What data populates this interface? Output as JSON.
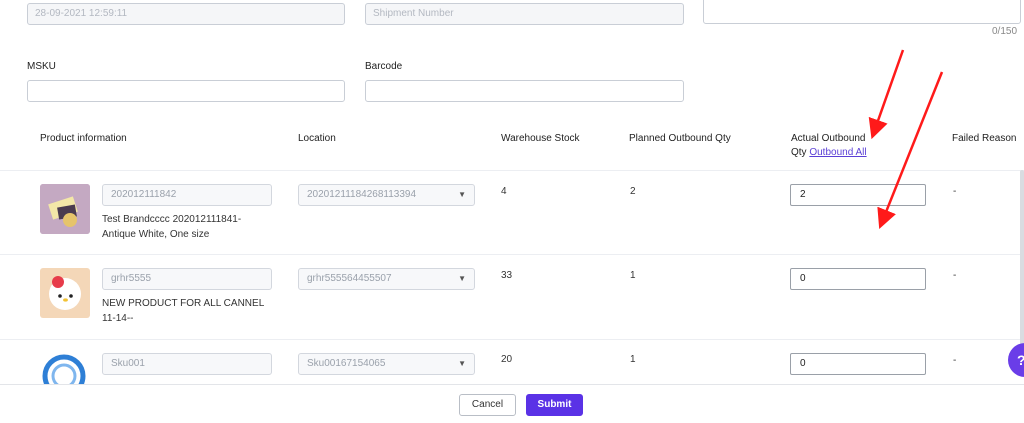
{
  "top_fields": {
    "date_value": "28-09-2021 12:59:11",
    "shipment_placeholder": "Shipment Number",
    "remark_counter": "0/150"
  },
  "filters": {
    "msku_label": "MSKU",
    "barcode_label": "Barcode"
  },
  "table": {
    "headers": {
      "product": "Product information",
      "location": "Location",
      "stock": "Warehouse Stock",
      "planned": "Planned Outbound Qty",
      "actual_line1": "Actual Outbound",
      "actual_line2": "Qty",
      "outbound_all": "Outbound All",
      "failed": "Failed Reason"
    },
    "rows": [
      {
        "sku": "202012111842",
        "name_line1": "Test Brandcccc 202012111841-",
        "name_line2": "Antique White, One size",
        "location": "2020121118426811339​4",
        "stock": "4",
        "planned": "2",
        "actual": "2",
        "failed": "-"
      },
      {
        "sku": "grhr5555",
        "name_line1": "NEW PRODUCT FOR ALL CANNEL",
        "name_line2": "11-14--",
        "location": "grhr555564455507",
        "stock": "33",
        "planned": "1",
        "actual": "0",
        "failed": "-"
      },
      {
        "sku": "Sku001",
        "name_line1": "",
        "name_line2": "",
        "location": "Sku00167154065",
        "stock": "20",
        "planned": "1",
        "actual": "0",
        "failed": "-"
      }
    ]
  },
  "footer": {
    "cancel_label": "Cancel",
    "submit_label": "Submit"
  },
  "colors": {
    "accent": "#5a32e6",
    "annotation_arrow": "#ff1a1a"
  }
}
